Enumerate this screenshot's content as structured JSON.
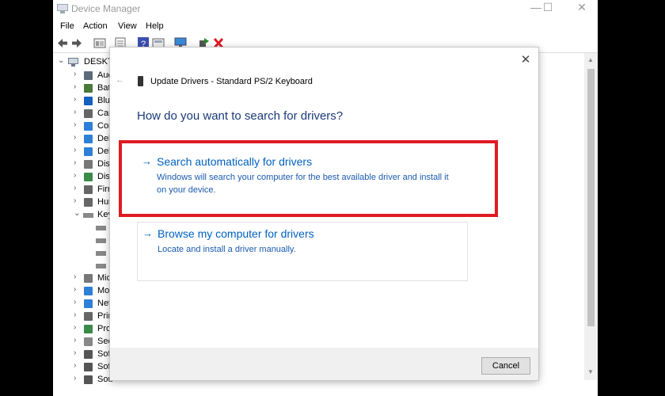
{
  "window": {
    "title": "Device Manager",
    "controls": {
      "minimize": "—",
      "maximize": "☐",
      "close": "✕"
    }
  },
  "menu": [
    "File",
    "Action",
    "View",
    "Help"
  ],
  "toolbar": {
    "icons": [
      "back-icon",
      "forward-icon",
      "properties-icon",
      "list-icon",
      "help-icon",
      "view-icon",
      "monitor-scan-icon",
      "update-driver-icon",
      "uninstall-icon"
    ],
    "uninstall_color": "#e01b24",
    "update_color": "#2a8a2a"
  },
  "tree": {
    "root": "DESKTO",
    "items": [
      {
        "expander": "›",
        "label": "Aud",
        "icon": "audio-icon",
        "color": "#5a6a7a"
      },
      {
        "expander": "›",
        "label": "Bat",
        "icon": "battery-icon",
        "color": "#4a7a3a"
      },
      {
        "expander": "›",
        "label": "Blu",
        "icon": "bluetooth-icon",
        "color": "#1560c0"
      },
      {
        "expander": "›",
        "label": "Can",
        "icon": "camera-icon",
        "color": "#666666"
      },
      {
        "expander": "›",
        "label": "Con",
        "icon": "computer-icon",
        "color": "#2d7fd8"
      },
      {
        "expander": "›",
        "label": "Del",
        "icon": "monitor-icon",
        "color": "#2d7fd8"
      },
      {
        "expander": "›",
        "label": "Del",
        "icon": "monitor-icon",
        "color": "#2d7fd8"
      },
      {
        "expander": "›",
        "label": "Disl",
        "icon": "disk-icon",
        "color": "#777777"
      },
      {
        "expander": "›",
        "label": "Disp",
        "icon": "display-adapter-icon",
        "color": "#3a8a4a"
      },
      {
        "expander": "›",
        "label": "Firm",
        "icon": "firmware-icon",
        "color": "#666666"
      },
      {
        "expander": "›",
        "label": "Hum",
        "icon": "hid-icon",
        "color": "#666666"
      },
      {
        "expander": "⌄",
        "label": "Key",
        "icon": "keyboard-icon",
        "color": "#888888"
      },
      {
        "expander": "",
        "label": "",
        "icon": "keyboard-icon",
        "color": "#888888"
      },
      {
        "expander": "",
        "label": "",
        "icon": "keyboard-icon",
        "color": "#888888"
      },
      {
        "expander": "",
        "label": "",
        "icon": "keyboard-icon",
        "color": "#888888"
      },
      {
        "expander": "",
        "label": "",
        "icon": "keyboard-icon",
        "color": "#888888"
      },
      {
        "expander": "›",
        "label": "Mic",
        "icon": "mouse-icon",
        "color": "#777777"
      },
      {
        "expander": "›",
        "label": "Mo",
        "icon": "monitor-icon",
        "color": "#2d7fd8"
      },
      {
        "expander": "›",
        "label": "Net",
        "icon": "network-icon",
        "color": "#2d7fd8"
      },
      {
        "expander": "›",
        "label": "Prin",
        "icon": "printer-icon",
        "color": "#666666"
      },
      {
        "expander": "›",
        "label": "Pro",
        "icon": "processor-icon",
        "color": "#3a8a4a"
      },
      {
        "expander": "›",
        "label": "Sec",
        "icon": "security-icon",
        "color": "#888888"
      },
      {
        "expander": "›",
        "label": "Sof",
        "icon": "software-icon",
        "color": "#555555"
      },
      {
        "expander": "›",
        "label": "Sof",
        "icon": "software-icon",
        "color": "#555555"
      },
      {
        "expander": "›",
        "label": "Sou",
        "icon": "sound-icon",
        "color": "#555555"
      }
    ]
  },
  "dialog": {
    "close": "✕",
    "back": "←",
    "title": "Update Drivers - Standard PS/2 Keyboard",
    "heading": "How do you want to search for drivers?",
    "option1": {
      "arrow": "→",
      "title": "Search automatically for drivers",
      "desc": "Windows will search your computer for the best available driver and install it on your device."
    },
    "option2": {
      "arrow": "→",
      "title": "Browse my computer for drivers",
      "desc": "Locate and install a driver manually."
    },
    "cancel": "Cancel",
    "highlight_color": "#e01b24",
    "link_color": "#0060c0"
  }
}
